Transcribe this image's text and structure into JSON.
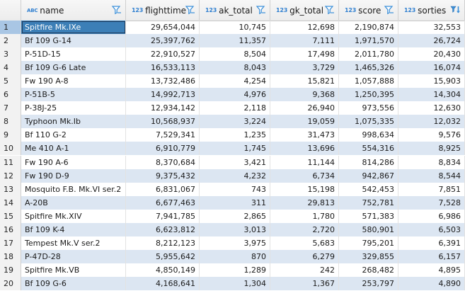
{
  "columns": [
    {
      "label": "name",
      "type": "ABC",
      "filter": "filter-icon"
    },
    {
      "label": "flighttime",
      "type": "123",
      "filter": "filter-icon"
    },
    {
      "label": "ak_total",
      "type": "123",
      "filter": "filter-icon"
    },
    {
      "label": "gk_total",
      "type": "123",
      "filter": "filter-icon"
    },
    {
      "label": "score",
      "type": "123",
      "filter": "filter-icon"
    },
    {
      "label": "sorties",
      "type": "123",
      "filter": "sort-desc-icon"
    }
  ],
  "rows": [
    {
      "num": "1",
      "cells": [
        "Spitfire Mk.IXe",
        "29,654,044",
        "10,745",
        "12,698",
        "2,190,874",
        "32,553"
      ]
    },
    {
      "num": "2",
      "cells": [
        "Bf 109 G-14",
        "25,397,762",
        "11,357",
        "7,111",
        "1,971,570",
        "26,724"
      ]
    },
    {
      "num": "3",
      "cells": [
        "P-51D-15",
        "22,910,527",
        "8,504",
        "17,498",
        "2,011,780",
        "20,430"
      ]
    },
    {
      "num": "4",
      "cells": [
        "Bf 109 G-6 Late",
        "16,533,113",
        "8,043",
        "3,729",
        "1,465,326",
        "16,074"
      ]
    },
    {
      "num": "5",
      "cells": [
        "Fw 190 A-8",
        "13,732,486",
        "4,254",
        "15,821",
        "1,057,888",
        "15,903"
      ]
    },
    {
      "num": "6",
      "cells": [
        "P-51B-5",
        "14,992,713",
        "4,976",
        "9,368",
        "1,250,395",
        "14,304"
      ]
    },
    {
      "num": "7",
      "cells": [
        "P-38J-25",
        "12,934,142",
        "2,118",
        "26,940",
        "973,556",
        "12,630"
      ]
    },
    {
      "num": "8",
      "cells": [
        "Typhoon Mk.Ib",
        "10,568,937",
        "3,224",
        "19,059",
        "1,075,335",
        "12,032"
      ]
    },
    {
      "num": "9",
      "cells": [
        "Bf 110 G-2",
        "7,529,341",
        "1,235",
        "31,473",
        "998,634",
        "9,576"
      ]
    },
    {
      "num": "10",
      "cells": [
        "Me 410 A-1",
        "6,910,779",
        "1,745",
        "13,696",
        "554,316",
        "8,925"
      ]
    },
    {
      "num": "11",
      "cells": [
        "Fw 190 A-6",
        "8,370,684",
        "3,421",
        "11,144",
        "814,286",
        "8,834"
      ]
    },
    {
      "num": "12",
      "cells": [
        "Fw 190 D-9",
        "9,375,432",
        "4,232",
        "6,734",
        "942,867",
        "8,544"
      ]
    },
    {
      "num": "13",
      "cells": [
        "Mosquito F.B. Mk.VI ser.2",
        "6,831,067",
        "743",
        "15,198",
        "542,453",
        "7,851"
      ]
    },
    {
      "num": "14",
      "cells": [
        "A-20B",
        "6,677,463",
        "311",
        "29,813",
        "752,781",
        "7,528"
      ]
    },
    {
      "num": "15",
      "cells": [
        "Spitfire Mk.XIV",
        "7,941,785",
        "2,865",
        "1,780",
        "571,383",
        "6,986"
      ]
    },
    {
      "num": "16",
      "cells": [
        "Bf 109 K-4",
        "6,623,812",
        "3,013",
        "2,720",
        "580,901",
        "6,503"
      ]
    },
    {
      "num": "17",
      "cells": [
        "Tempest Mk.V ser.2",
        "8,212,123",
        "3,975",
        "5,683",
        "795,201",
        "6,391"
      ]
    },
    {
      "num": "18",
      "cells": [
        "P-47D-28",
        "5,955,642",
        "870",
        "6,279",
        "329,855",
        "6,157"
      ]
    },
    {
      "num": "19",
      "cells": [
        "Spitfire Mk.VB",
        "4,850,149",
        "1,289",
        "242",
        "268,482",
        "4,895"
      ]
    },
    {
      "num": "20",
      "cells": [
        "Bf 109 G-6",
        "4,168,641",
        "1,304",
        "1,367",
        "253,797",
        "4,890"
      ]
    }
  ],
  "colors": {
    "selection": "#3c7fb7",
    "stripe": "#dce6f2",
    "type_icon": "#2f7fd0"
  }
}
